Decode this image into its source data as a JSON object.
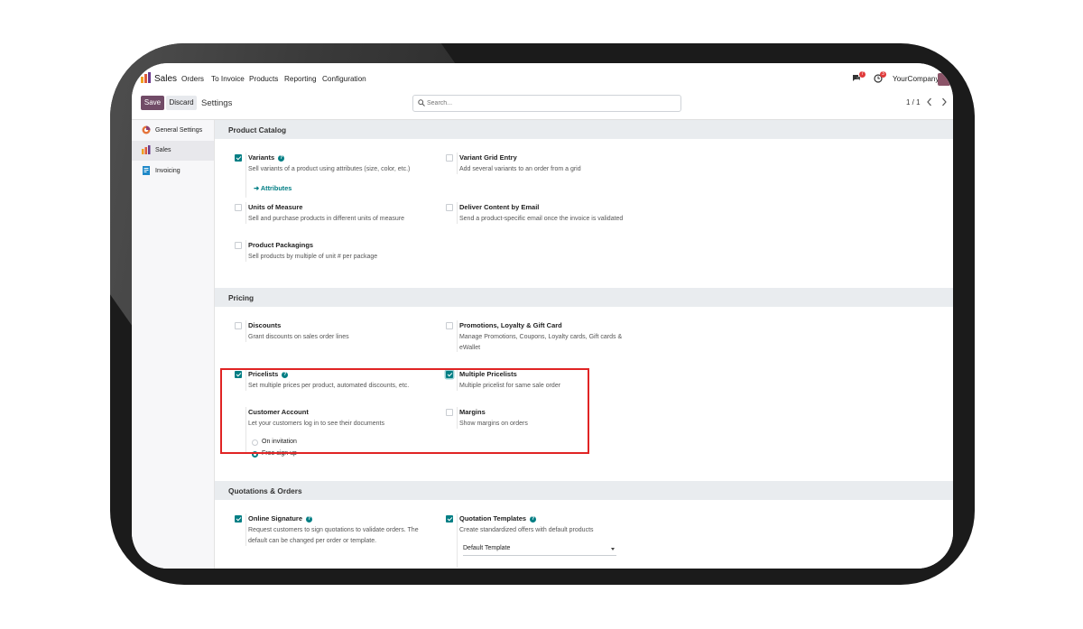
{
  "navbar": {
    "app_name": "Sales",
    "menu": [
      "Orders",
      "To Invoice",
      "Products",
      "Reporting",
      "Configuration"
    ],
    "messages_count": "7",
    "activities_count": "3",
    "company": "YourCompany"
  },
  "control_panel": {
    "save_label": "Save",
    "discard_label": "Discard",
    "title": "Settings",
    "search_placeholder": "Search...",
    "pager": "1 / 1"
  },
  "sidebar": {
    "items": [
      {
        "label": "General Settings",
        "icon": "odoo-icon",
        "active": false
      },
      {
        "label": "Sales",
        "icon": "sales-icon",
        "active": true
      },
      {
        "label": "Invoicing",
        "icon": "invoicing-icon",
        "active": false
      }
    ]
  },
  "sections": {
    "product_catalog": {
      "title": "Product Catalog",
      "variants": {
        "title": "Variants",
        "desc": "Sell variants of a product using attributes (size, color, etc.)",
        "checked": true,
        "link": "Attributes"
      },
      "variant_grid": {
        "title": "Variant Grid Entry",
        "desc": "Add several variants to an order from a grid",
        "checked": false
      },
      "uom": {
        "title": "Units of Measure",
        "desc": "Sell and purchase products in different units of measure",
        "checked": false
      },
      "deliver_email": {
        "title": "Deliver Content by Email",
        "desc": "Send a product-specific email once the invoice is validated",
        "checked": false
      },
      "packagings": {
        "title": "Product Packagings",
        "desc": "Sell products by multiple of unit # per package",
        "checked": false
      }
    },
    "pricing": {
      "title": "Pricing",
      "discounts": {
        "title": "Discounts",
        "desc": "Grant discounts on sales order lines",
        "checked": false
      },
      "promotions": {
        "title": "Promotions, Loyalty & Gift Card",
        "desc": "Manage Promotions, Coupons, Loyalty cards, Gift cards & eWallet",
        "checked": false
      },
      "pricelists": {
        "title": "Pricelists",
        "desc": "Set multiple prices per product, automated discounts, etc.",
        "checked": true
      },
      "multiple_pricelists": {
        "title": "Multiple Pricelists",
        "desc": "Multiple pricelist for same sale order",
        "checked": true
      },
      "customer_account": {
        "title": "Customer Account",
        "desc": "Let your customers log in to see their documents",
        "options": [
          "On invitation",
          "Free sign up"
        ],
        "selected": "Free sign up"
      },
      "margins": {
        "title": "Margins",
        "desc": "Show margins on orders",
        "checked": false
      }
    },
    "quotations": {
      "title": "Quotations & Orders",
      "online_signature": {
        "title": "Online Signature",
        "desc": "Request customers to sign quotations to validate orders. The default can be changed per order or template.",
        "checked": true
      },
      "quotation_templates": {
        "title": "Quotation Templates",
        "desc": "Create standardized offers with default products",
        "checked": true,
        "default_template": "Default Template"
      }
    }
  },
  "colors": {
    "accent": "#017e84",
    "brand": "#714b67",
    "highlight": "#e02424"
  }
}
